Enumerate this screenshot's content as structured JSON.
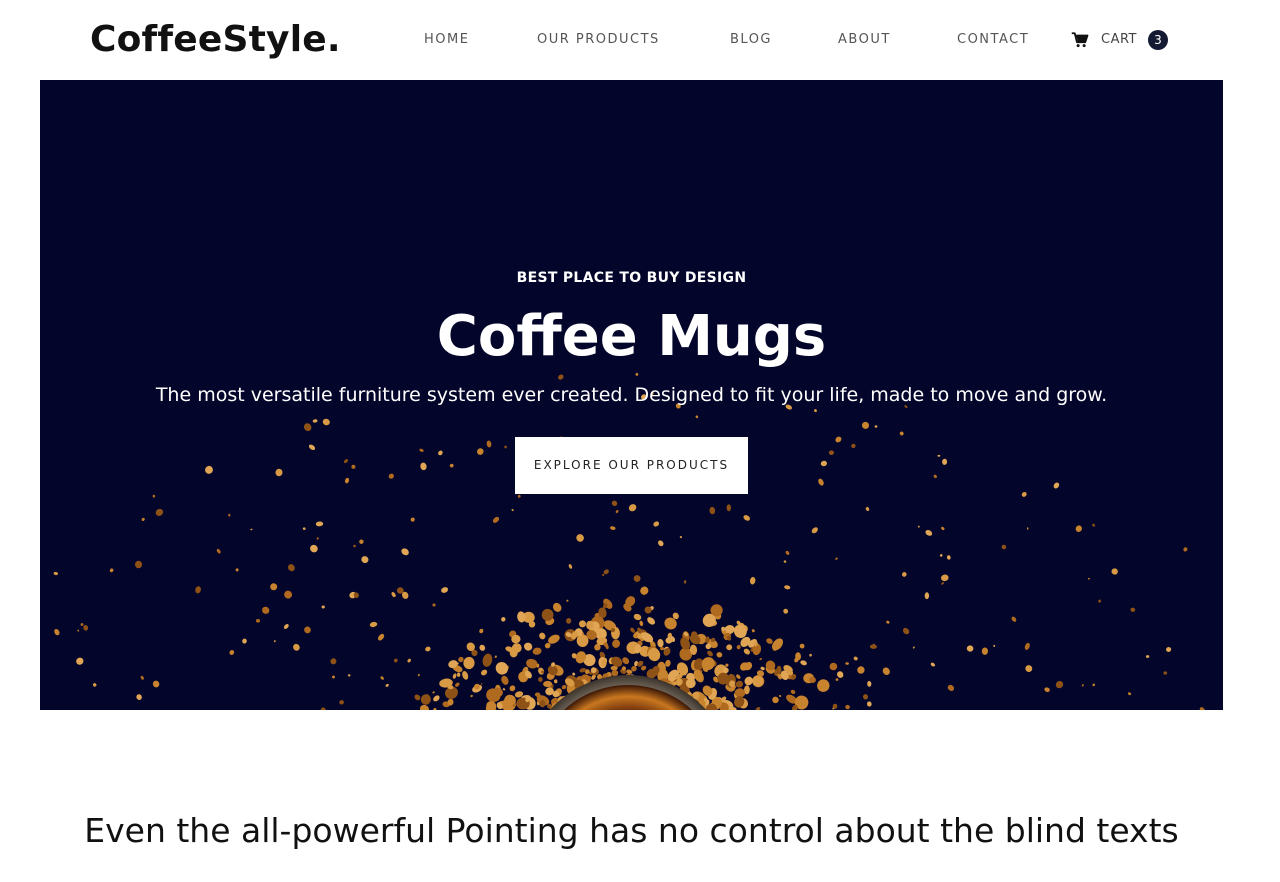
{
  "brand": {
    "logo": "CoffeeStyle."
  },
  "nav": {
    "items": [
      {
        "label": "HOME"
      },
      {
        "label": "OUR PRODUCTS"
      },
      {
        "label": "BLOG"
      },
      {
        "label": "ABOUT"
      },
      {
        "label": "CONTACT"
      }
    ],
    "cart": {
      "icon": "cart-icon",
      "label": "CART",
      "count": "3"
    }
  },
  "hero": {
    "kicker": "BEST PLACE TO BUY DESIGN",
    "title": "Coffee Mugs",
    "subtitle": "The most versatile furniture system ever created. Designed to fit your life, made to move and grow.",
    "cta_label": "EXPLORE OUR PRODUCTS",
    "background_color": "#04052a",
    "image": "coffee-cup-with-scattered-granules"
  },
  "section": {
    "heading": "Even the all-powerful Pointing has no control about the blind texts"
  },
  "colors": {
    "badge": "#151a33",
    "granule": "#c8832e"
  }
}
